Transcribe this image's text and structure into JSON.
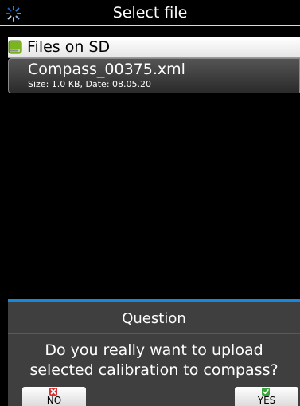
{
  "titlebar": {
    "title": "Select file",
    "spinner_icon": "loading-spinner-icon"
  },
  "source": {
    "label": "Files on SD",
    "icon": "sd-card-icon"
  },
  "files": [
    {
      "name": "Compass_00375.xml",
      "meta": "Size: 1.0 KB, Date: 08.05.20"
    }
  ],
  "dialog": {
    "title": "Question",
    "message_line1": "Do you really want to upload",
    "message_line2": "selected calibration to compass?",
    "no_label": "NO",
    "yes_label": "YES",
    "no_icon": "red-x-icon",
    "yes_icon": "green-check-icon"
  },
  "colors": {
    "background": "#000000",
    "dialog_bg": "#3f3f3f",
    "accent": "#1a86d8",
    "sd_green": "#7ab520",
    "no_red": "#d93030",
    "yes_green": "#3aa83a"
  }
}
